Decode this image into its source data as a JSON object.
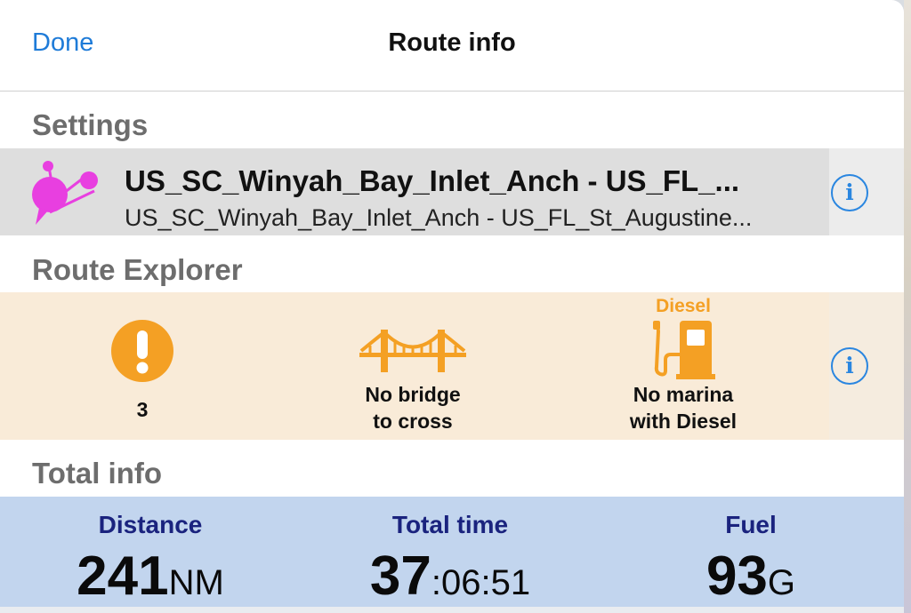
{
  "header": {
    "done_label": "Done",
    "title": "Route info"
  },
  "settings": {
    "section_title": "Settings",
    "route_name": "US_SC_Winyah_Bay_Inlet_Anch - US_FL_...",
    "route_subtitle": "US_SC_Winyah_Bay_Inlet_Anch - US_FL_St_Augustine...",
    "route_icon": "route-waypoints-icon",
    "info_icon": "info-icon"
  },
  "route_explorer": {
    "section_title": "Route Explorer",
    "items": [
      {
        "icon": "warning-icon",
        "label": "3"
      },
      {
        "icon": "bridge-icon",
        "label_line1": "No bridge",
        "label_line2": "to cross"
      },
      {
        "icon": "fuel-pump-icon",
        "badge": "Diesel",
        "label_line1": "No marina",
        "label_line2": "with Diesel"
      }
    ],
    "info_icon": "info-icon"
  },
  "total_info": {
    "section_title": "Total info",
    "distance": {
      "label": "Distance",
      "value": "241",
      "unit": "NM"
    },
    "total_time": {
      "label": "Total time",
      "hours": "37",
      "rest": ":06:51"
    },
    "fuel": {
      "label": "Fuel",
      "value": "93",
      "unit": "G"
    }
  },
  "colors": {
    "accent_blue": "#1e7bd8",
    "route_magenta": "#e83fe0",
    "warning_orange": "#f4a024",
    "total_label_navy": "#1a237e",
    "settings_row_bg": "#dedede",
    "explorer_row_bg": "#f9ebd8",
    "total_row_bg": "#c2d5ee"
  }
}
